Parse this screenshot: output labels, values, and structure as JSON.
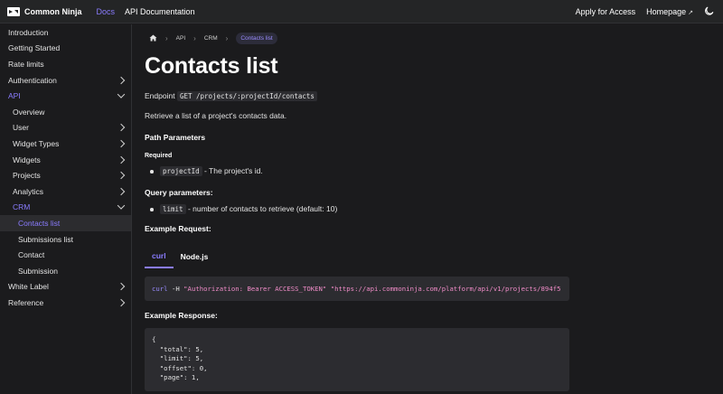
{
  "topbar": {
    "brand": "Common Ninja",
    "nav": [
      "Docs",
      "API Documentation"
    ],
    "apply": "Apply for Access",
    "homepage": "Homepage",
    "theme_icon": "moon-icon"
  },
  "sidebar": {
    "items": [
      {
        "label": "Introduction"
      },
      {
        "label": "Getting Started"
      },
      {
        "label": "Rate limits"
      },
      {
        "label": "Authentication"
      },
      {
        "label": "API"
      },
      {
        "label": "Overview"
      },
      {
        "label": "User"
      },
      {
        "label": "Widget Types"
      },
      {
        "label": "Widgets"
      },
      {
        "label": "Projects"
      },
      {
        "label": "Analytics"
      },
      {
        "label": "CRM"
      },
      {
        "label": "Contacts list"
      },
      {
        "label": "Submissions list"
      },
      {
        "label": "Contact"
      },
      {
        "label": "Submission"
      },
      {
        "label": "White Label"
      },
      {
        "label": "Reference"
      }
    ]
  },
  "breadcrumb": [
    "API",
    "CRM",
    "Contacts list"
  ],
  "page": {
    "title": "Contacts list",
    "endpoint_label": "Endpoint",
    "endpoint": "GET /projects/:projectId/contacts",
    "description": "Retrieve a list of a project's contacts data.",
    "path_params_heading": "Path Parameters",
    "required_label": "Required",
    "path_param_name": "projectId",
    "path_param_desc": " - The project's id.",
    "query_heading": "Query parameters:",
    "query_param_name": "limit",
    "query_param_desc": " - number of contacts to retrieve (default: 10)",
    "example_request_heading": "Example Request:",
    "tabs": [
      "curl",
      "Node.js"
    ],
    "code": {
      "cmd": "curl",
      "flag": " -H ",
      "header": "\"Authorization: Bearer ACCESS_TOKEN\"",
      "url": " \"https://api.commoninja.com/platform/api/v1/projects/894f5"
    },
    "example_response_heading": "Example Response:",
    "response_lines": [
      "{",
      "  \"total\": 5,",
      "  \"limit\": 5,",
      "  \"offset\": 0,",
      "  \"page\": 1,"
    ]
  },
  "colors": {
    "accent": "#8a7cff",
    "background": "#1b1b1d",
    "code_string": "#f08cc8"
  }
}
